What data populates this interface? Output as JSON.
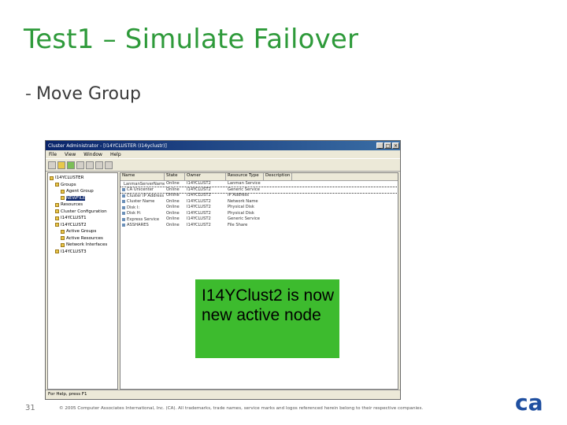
{
  "slide": {
    "title": "Test1 – Simulate Failover",
    "bullet": "Move Group",
    "callout": "I14YClust2 is now new active node",
    "page_number": "31",
    "copyright": "© 2005 Computer Associates International, Inc. (CA). All trademarks, trade names, service marks and logos referenced herein belong to their respective companies.",
    "brand_color": "#2e9a3a",
    "callout_color": "#3dbb2e"
  },
  "window": {
    "title": "Cluster Administrator - [I14YCLUSTER (I14yclustr)]",
    "buttons": [
      "_",
      "□",
      "×"
    ],
    "menu": [
      "File",
      "View",
      "Window",
      "Help"
    ],
    "tree": [
      {
        "label": "I14YCLUSTER",
        "indent": 0
      },
      {
        "label": "Groups",
        "indent": 1
      },
      {
        "label": "Agent Group",
        "indent": 2
      },
      {
        "label": "NEWFILE",
        "indent": 2,
        "selected": true
      },
      {
        "label": "Resources",
        "indent": 1
      },
      {
        "label": "Cluster Configuration",
        "indent": 1
      },
      {
        "label": "I14YCLUST1",
        "indent": 1
      },
      {
        "label": "I14YCLUST2",
        "indent": 1
      },
      {
        "label": "Active Groups",
        "indent": 2
      },
      {
        "label": "Active Resources",
        "indent": 2
      },
      {
        "label": "Network Interfaces",
        "indent": 2
      },
      {
        "label": "I14YCLUST3",
        "indent": 1
      }
    ],
    "columns": [
      "Name",
      "State",
      "Owner",
      "Resource Type",
      "Description"
    ],
    "rows": [
      {
        "name": "LanmanServerName...",
        "state": "Online",
        "owner": "I14YCLUST2",
        "type": "Lanman Service",
        "desc": ""
      },
      {
        "name": "CA Unicenter",
        "state": "Online",
        "owner": "I14YCLUST2",
        "type": "Generic Service",
        "desc": ""
      },
      {
        "name": "Cluster IP Address",
        "state": "Online",
        "owner": "I14YCLUST2",
        "type": "IP Address",
        "desc": ""
      },
      {
        "name": "Cluster Name",
        "state": "Online",
        "owner": "I14YCLUST2",
        "type": "Network Name",
        "desc": ""
      },
      {
        "name": "Disk I:",
        "state": "Online",
        "owner": "I14YCLUST2",
        "type": "Physical Disk",
        "desc": ""
      },
      {
        "name": "Disk H:",
        "state": "Online",
        "owner": "I14YCLUST2",
        "type": "Physical Disk",
        "desc": ""
      },
      {
        "name": "Express Service",
        "state": "Online",
        "owner": "I14YCLUST2",
        "type": "Generic Service",
        "desc": ""
      },
      {
        "name": "ASSHARES",
        "state": "Online",
        "owner": "I14YCLUST2",
        "type": "File Share",
        "desc": ""
      }
    ],
    "status": "For Help, press F1"
  },
  "logo": {
    "text": "ca",
    "color": "#1f4fa0"
  }
}
